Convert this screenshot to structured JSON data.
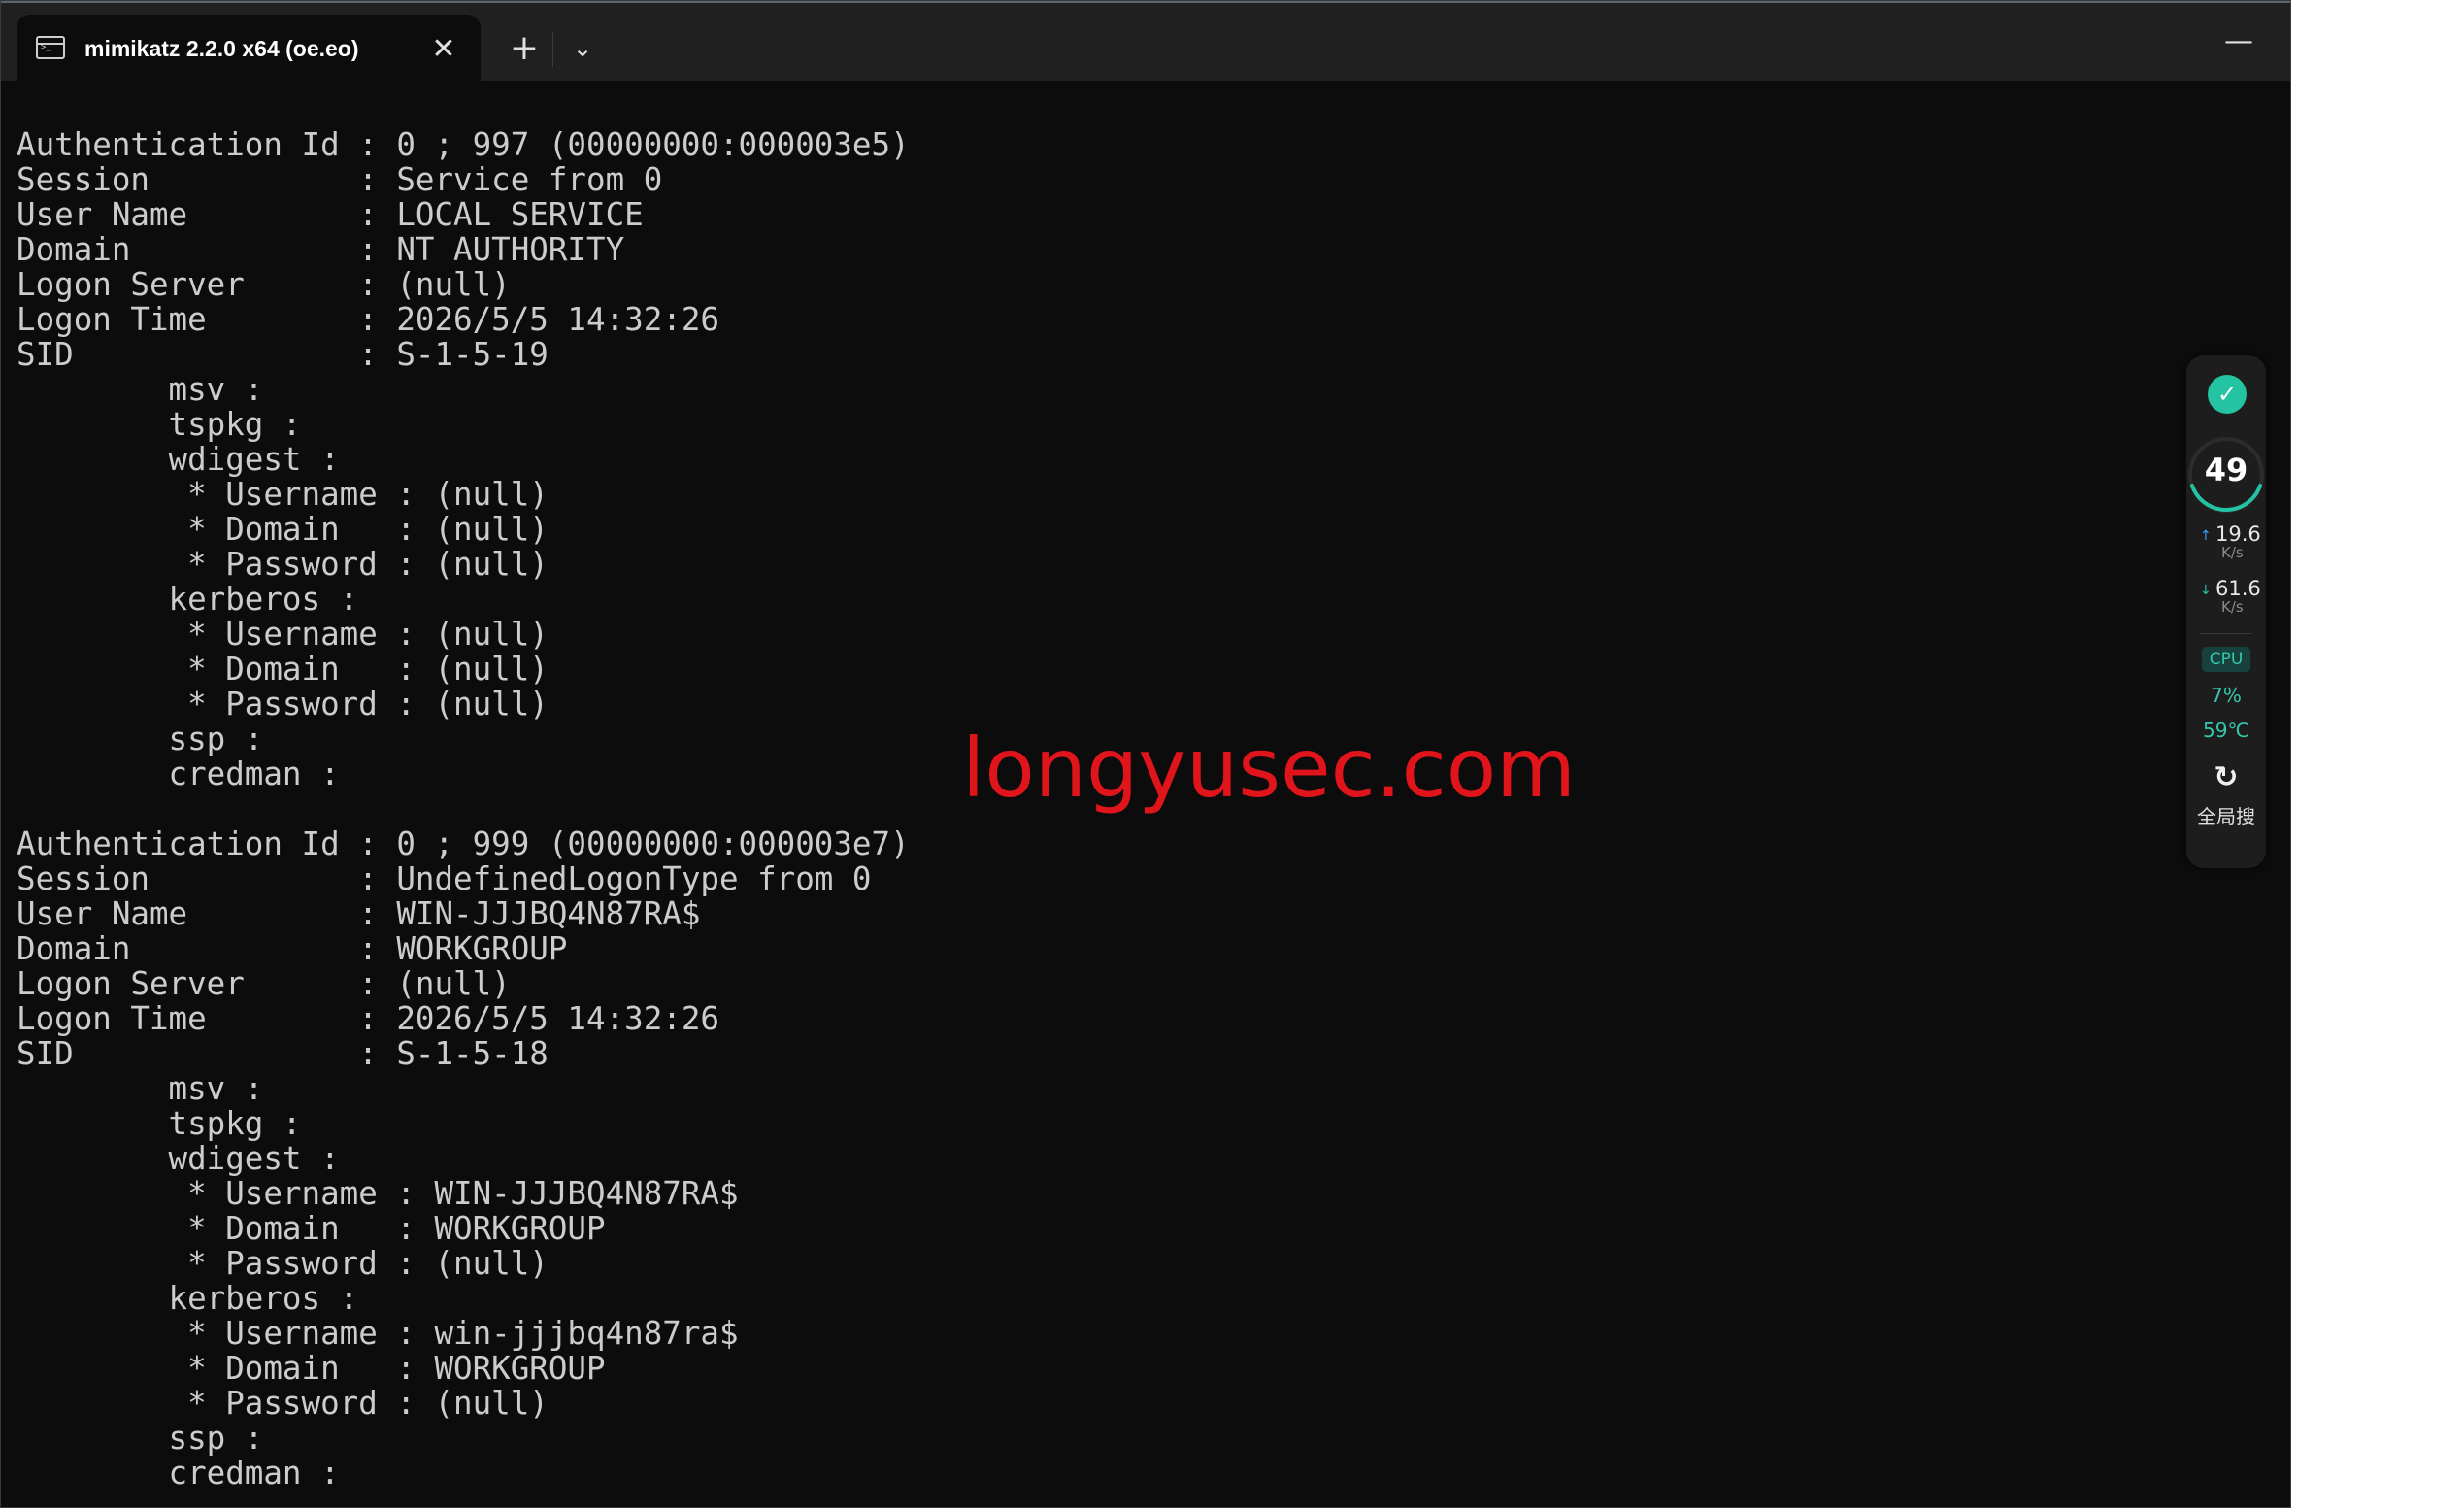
{
  "window": {
    "tab_title": "mimikatz 2.2.0 x64 (oe.eo)",
    "tab_icon": "terminal-icon",
    "close_glyph": "✕",
    "new_tab_glyph": "+",
    "dropdown_glyph": "⌄",
    "minimize_glyph": "—"
  },
  "console": {
    "lines": [
      "Authentication Id : 0 ; 997 (00000000:000003e5)",
      "Session           : Service from 0",
      "User Name         : LOCAL SERVICE",
      "Domain            : NT AUTHORITY",
      "Logon Server      : (null)",
      "Logon Time        : 2026/5/5 14:32:26",
      "SID               : S-1-5-19",
      "        msv :",
      "        tspkg :",
      "        wdigest :",
      "         * Username : (null)",
      "         * Domain   : (null)",
      "         * Password : (null)",
      "        kerberos :",
      "         * Username : (null)",
      "         * Domain   : (null)",
      "         * Password : (null)",
      "        ssp :",
      "        credman :",
      "",
      "Authentication Id : 0 ; 999 (00000000:000003e7)",
      "Session           : UndefinedLogonType from 0",
      "User Name         : WIN-JJJBQ4N87RA$",
      "Domain            : WORKGROUP",
      "Logon Server      : (null)",
      "Logon Time        : 2026/5/5 14:32:26",
      "SID               : S-1-5-18",
      "        msv :",
      "        tspkg :",
      "        wdigest :",
      "         * Username : WIN-JJJBQ4N87RA$",
      "         * Domain   : WORKGROUP",
      "         * Password : (null)",
      "        kerberos :",
      "         * Username : win-jjjbq4n87ra$",
      "         * Domain   : WORKGROUP",
      "         * Password : (null)",
      "        ssp :",
      "        credman :"
    ]
  },
  "watermark": "longyusec.com",
  "widget": {
    "status_icon": "check-icon",
    "score": "49",
    "upload_speed": "19.6",
    "upload_unit": "K/s",
    "download_speed": "61.6",
    "download_unit": "K/s",
    "cpu_label": "CPU",
    "cpu_percent": "7%",
    "cpu_temp": "59℃",
    "search_label": "全局搜",
    "colors": {
      "accent": "#23c3a4",
      "upload": "#3aa0ff"
    }
  }
}
